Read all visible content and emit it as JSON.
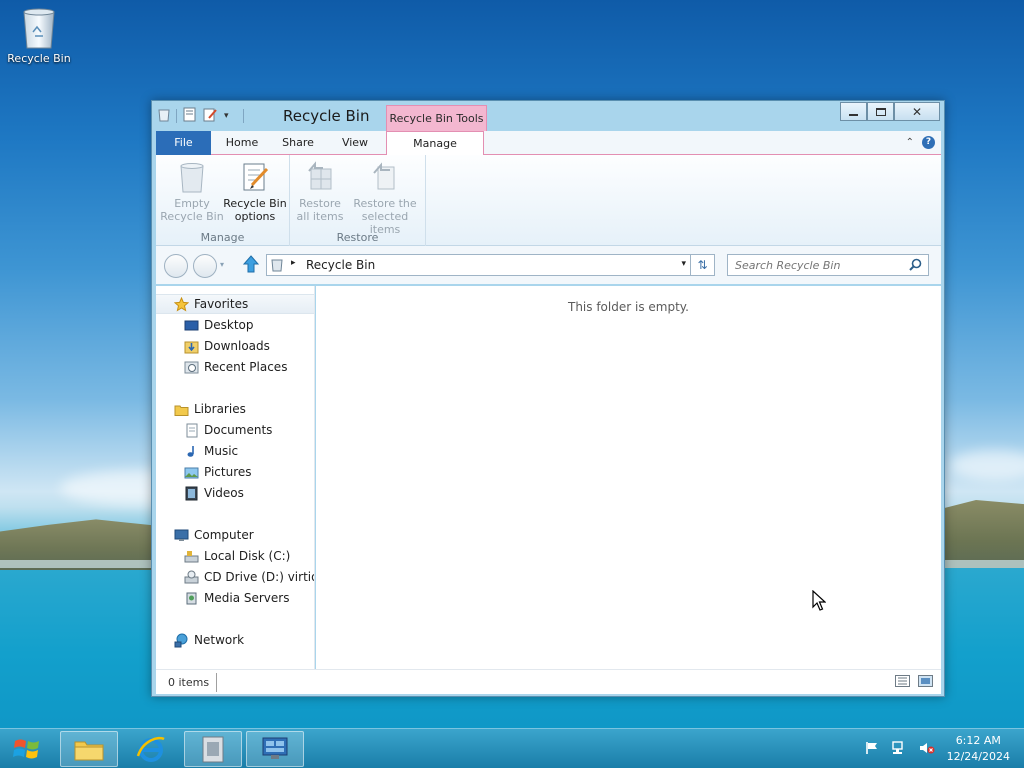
{
  "desktop": {
    "recycle_bin_label": "Recycle Bin"
  },
  "window": {
    "title": "Recycle Bin",
    "contextual_tab_title": "Recycle Bin Tools",
    "tabs": {
      "file": "File",
      "home": "Home",
      "share": "Share",
      "view": "View",
      "manage": "Manage"
    },
    "ribbon": {
      "empty_line1": "Empty",
      "empty_line2": "Recycle Bin",
      "options_line1": "Recycle Bin",
      "options_line2": "options",
      "manage_group": "Manage",
      "restore_all_line1": "Restore",
      "restore_all_line2": "all items",
      "restore_sel_line1": "Restore the",
      "restore_sel_line2": "selected items",
      "restore_group": "Restore"
    },
    "address": {
      "location": "Recycle Bin",
      "search_placeholder": "Search Recycle Bin"
    },
    "nav": {
      "favorites": "Favorites",
      "desktop": "Desktop",
      "downloads": "Downloads",
      "recent_places": "Recent Places",
      "libraries": "Libraries",
      "documents": "Documents",
      "music": "Music",
      "pictures": "Pictures",
      "videos": "Videos",
      "computer": "Computer",
      "local_disk": "Local Disk (C:)",
      "cd_drive": "CD Drive (D:) virtio-win",
      "media_servers": "Media Servers",
      "network": "Network"
    },
    "content": {
      "empty_message": "This folder is empty."
    },
    "status": {
      "item_count": "0 items"
    }
  },
  "taskbar": {
    "time": "6:12 AM",
    "date": "12/24/2024"
  }
}
